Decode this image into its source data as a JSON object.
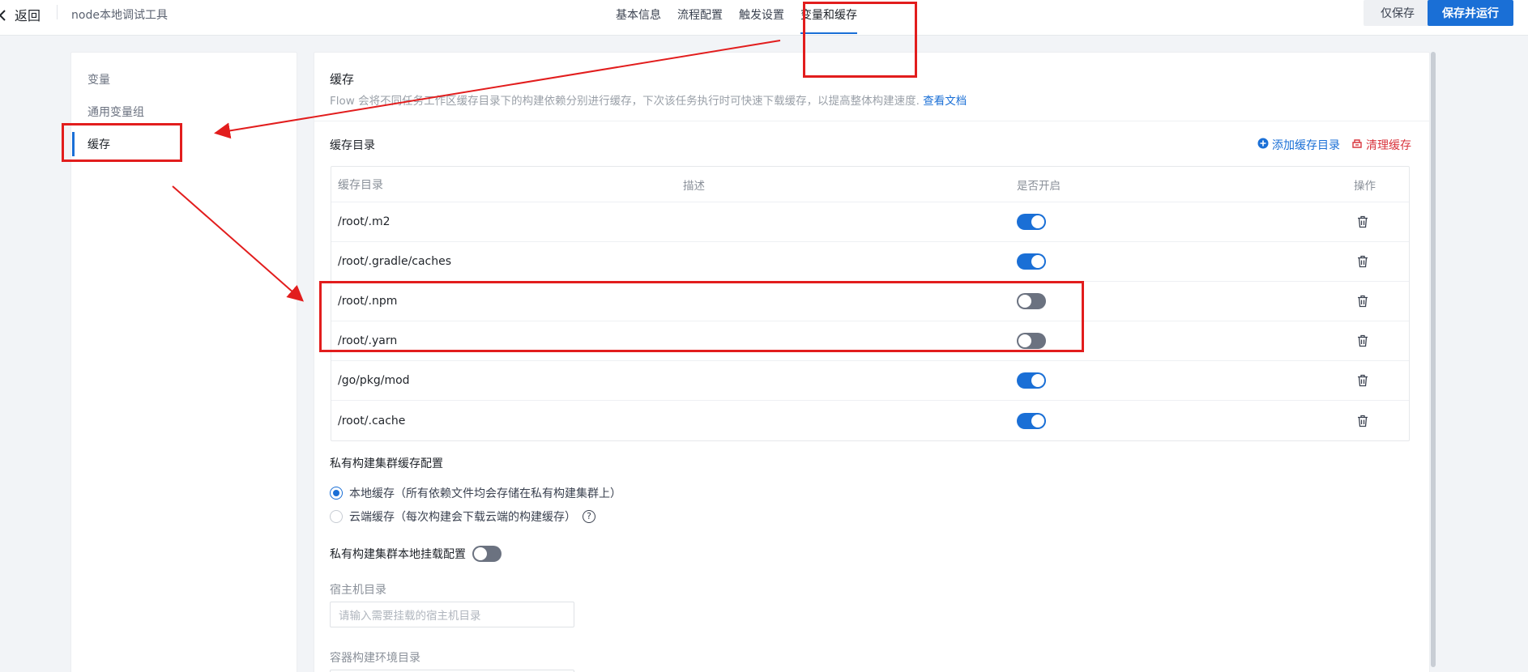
{
  "header": {
    "back_label": "返回",
    "app_title": "node本地调试工具",
    "tabs": [
      {
        "label": "基本信息",
        "active": false
      },
      {
        "label": "流程配置",
        "active": false
      },
      {
        "label": "触发设置",
        "active": false
      },
      {
        "label": "变量和缓存",
        "active": true
      }
    ],
    "save_only_label": "仅保存",
    "save_run_label": "保存并运行"
  },
  "sidebar": {
    "items": [
      {
        "label": "变量",
        "active": false
      },
      {
        "label": "通用变量组",
        "active": false
      },
      {
        "label": "缓存",
        "active": true
      }
    ]
  },
  "main": {
    "title": "缓存",
    "description": "Flow 会将不同任务工作区缓存目录下的构建依赖分别进行缓存，下次该任务执行时可快速下载缓存，以提高整体构建速度.",
    "doc_link": "查看文档",
    "cache_dir_title": "缓存目录",
    "add_cache_label": "添加缓存目录",
    "clear_cache_label": "清理缓存",
    "table": {
      "headers": [
        "缓存目录",
        "描述",
        "是否开启",
        "操作"
      ],
      "rows": [
        {
          "dir": "/root/.m2",
          "desc": "",
          "enabled": true
        },
        {
          "dir": "/root/.gradle/caches",
          "desc": "",
          "enabled": true
        },
        {
          "dir": "/root/.npm",
          "desc": "",
          "enabled": false
        },
        {
          "dir": "/root/.yarn",
          "desc": "",
          "enabled": false
        },
        {
          "dir": "/go/pkg/mod",
          "desc": "",
          "enabled": true
        },
        {
          "dir": "/root/.cache",
          "desc": "",
          "enabled": true
        }
      ]
    },
    "private_cache_title": "私有构建集群缓存配置",
    "radio_local_label": "本地缓存（所有依赖文件均会存储在私有构建集群上）",
    "radio_cloud_label": "云端缓存（每次构建会下载云端的构建缓存）",
    "help_glyph": "?",
    "mount_title": "私有构建集群本地挂载配置",
    "mount_enabled": false,
    "host_dir_label": "宿主机目录",
    "host_dir_placeholder": "请输入需要挂载的宿主机目录",
    "container_dir_label": "容器构建环境目录"
  },
  "colors": {
    "accent": "#1a6fd6",
    "danger": "#d9363e",
    "annotation": "#e21d1d"
  }
}
